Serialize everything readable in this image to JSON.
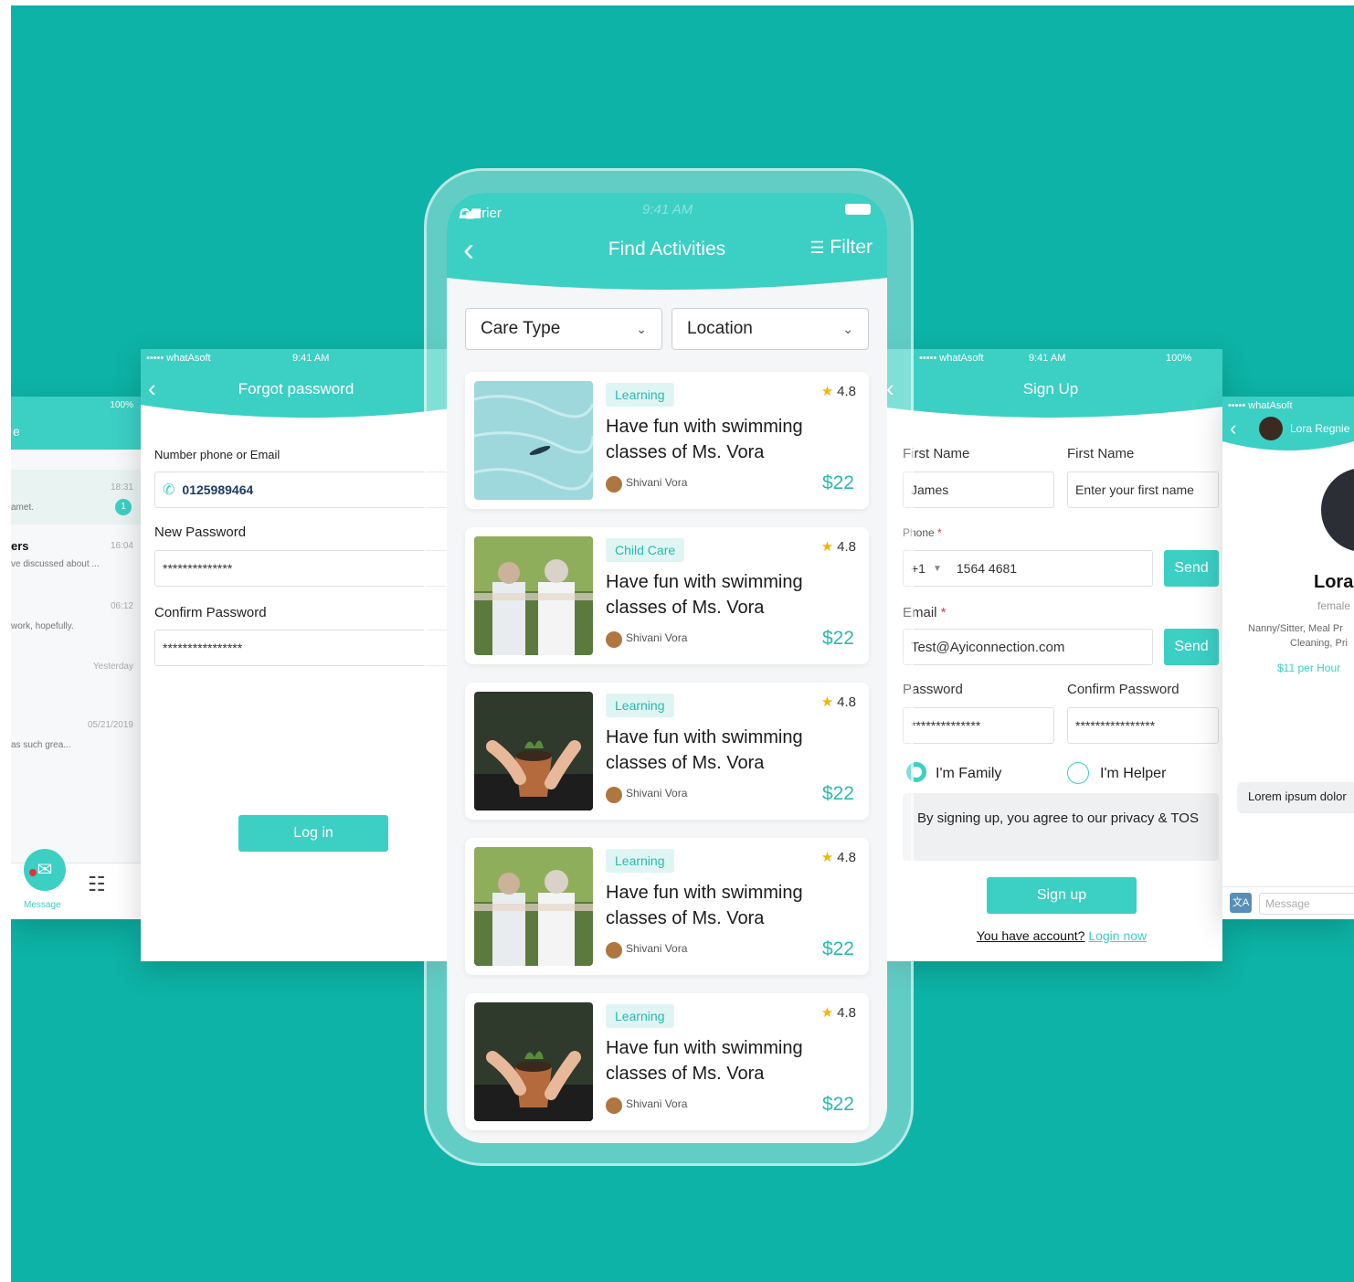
{
  "colors": {
    "background": "#0db3a6",
    "accent": "#3ccfc4",
    "price": "#2cb9ae"
  },
  "messages_screen": {
    "battery": "100%",
    "title_fragment": "e",
    "items": [
      {
        "time": "18:31",
        "preview": "amet.",
        "badge": "1"
      },
      {
        "name": "ers",
        "time": "16:04",
        "preview": "ve discussed about ..."
      },
      {
        "time": "06:12",
        "preview": "work, hopefully."
      },
      {
        "time": "Yesterday",
        "preview": ""
      },
      {
        "time": "05/21/2019",
        "preview": "as such grea..."
      }
    ],
    "nav_label": "Message"
  },
  "forgot_screen": {
    "status": {
      "carrier": "••••• whatAsoft",
      "time": "9:41 AM"
    },
    "title": "Forgot password",
    "contact_label": "Number phone or Email",
    "contact_value": "0125989464",
    "new_pw_label": "New Password",
    "new_pw_value": "**************",
    "confirm_label": "Confirm Password",
    "confirm_value": "****************",
    "login_button": "Log in"
  },
  "main_screen": {
    "status": {
      "carrier": "Carrier",
      "time": "9:41 AM"
    },
    "title": "Find Activities",
    "filter_label": "Filter",
    "dropdowns": [
      "Care Type",
      "Location"
    ],
    "cards": [
      {
        "tag": "Learning",
        "rating": "4.8",
        "title": "Have fun with swimming classes of Ms. Vora",
        "author": "Shivani Vora",
        "price": "$22",
        "image": "pool"
      },
      {
        "tag": "Child Care",
        "rating": "4.8",
        "title": "Have fun with swimming classes of Ms. Vora",
        "author": "Shivani Vora",
        "price": "$22",
        "image": "seniors"
      },
      {
        "tag": "Learning",
        "rating": "4.8",
        "title": "Have fun with swimming classes of Ms. Vora",
        "author": "Shivani Vora",
        "price": "$22",
        "image": "plant"
      },
      {
        "tag": "Learning",
        "rating": "4.8",
        "title": "Have fun with swimming classes of Ms. Vora",
        "author": "Shivani Vora",
        "price": "$22",
        "image": "seniors"
      },
      {
        "tag": "Learning",
        "rating": "4.8",
        "title": "Have fun with swimming classes of Ms. Vora",
        "author": "Shivani Vora",
        "price": "$22",
        "image": "plant"
      }
    ]
  },
  "signup_screen": {
    "status": {
      "carrier": "••••• whatAsoft",
      "time": "9:41 AM",
      "battery": "100%"
    },
    "title": "Sign Up",
    "first_name_label_1": "First Name",
    "first_name_value": "James",
    "first_name_label_2": "First Name",
    "first_name_placeholder": "Enter your first name",
    "phone_label": "Phone",
    "phone_code": "+1",
    "phone_value": "1564 4681",
    "send_label": "Send",
    "email_label": "Email",
    "email_value": "Test@Ayiconnection.com",
    "password_label": "Password",
    "password_value": "**************",
    "confirm_label": "Confirm Password",
    "confirm_value": "****************",
    "radio_family": "I'm Family",
    "radio_helper": "I'm Helper",
    "terms": "By signing up, you agree to our privacy & TOS",
    "signup_button": "Sign up",
    "have_account": "You have account?",
    "login_link": "Login now"
  },
  "profile_screen": {
    "status": {
      "carrier": "••••• whatAsoft"
    },
    "contact_name": "Lora Regnie",
    "name": "Lora",
    "gender": "female",
    "services_1": "Nanny/Sitter, Meal Pr",
    "services_2": "Cleaning, Pri",
    "rate": "$11 per Hour",
    "bubble": "Lorem ipsum dolor",
    "message_placeholder": "Message"
  }
}
